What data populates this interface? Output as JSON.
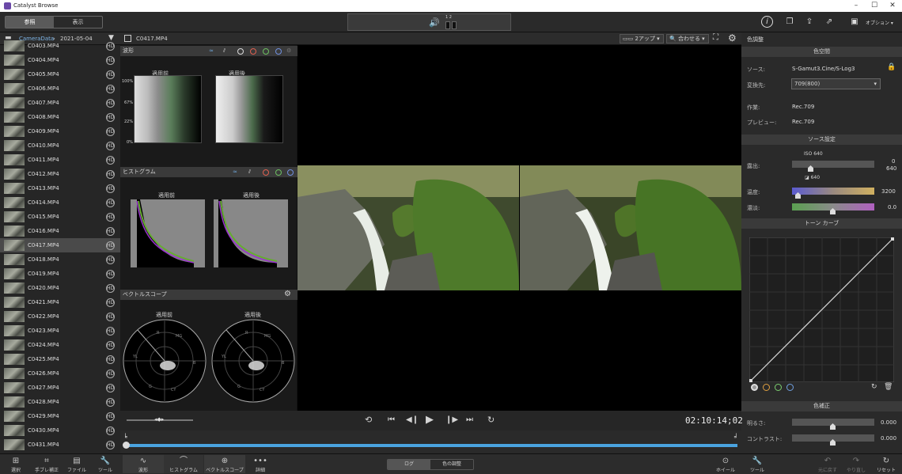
{
  "app": {
    "title": "Catalyst Browse"
  },
  "toolbar": {
    "tab_browse": "参照",
    "tab_view": "表示",
    "options": "オプション",
    "vol_top": "1 2"
  },
  "left": {
    "breadcrumb_root": "CameraData",
    "breadcrumb_date": "2021-05-04",
    "clips": [
      "C0403.MP4",
      "C0404.MP4",
      "C0405.MP4",
      "C0406.MP4",
      "C0407.MP4",
      "C0408.MP4",
      "C0409.MP4",
      "C0410.MP4",
      "C0411.MP4",
      "C0412.MP4",
      "C0413.MP4",
      "C0414.MP4",
      "C0415.MP4",
      "C0416.MP4",
      "C0417.MP4",
      "C0418.MP4",
      "C0419.MP4",
      "C0420.MP4",
      "C0421.MP4",
      "C0422.MP4",
      "C0423.MP4",
      "C0424.MP4",
      "C0425.MP4",
      "C0426.MP4",
      "C0427.MP4",
      "C0428.MP4",
      "C0429.MP4",
      "C0430.MP4",
      "C0431.MP4"
    ],
    "selected": "C0417.MP4"
  },
  "viewer": {
    "clip_name": "C0417.MP4",
    "layout": "2アップ",
    "fit": "合わせる"
  },
  "scopes": {
    "waveform": "波形",
    "histogram": "ヒストグラム",
    "vectorscope": "ベクトルスコープ",
    "before": "適用前",
    "after": "適用後",
    "wf_100": "100%",
    "wf_67": "67%",
    "wf_22": "22%",
    "wf_0": "0%",
    "vs_r": "R",
    "vs_mg": "MG",
    "vs_b": "B",
    "vs_cy": "CY",
    "vs_g": "G",
    "vs_yl": "YL"
  },
  "right": {
    "title": "色調整",
    "color_space": "色空間",
    "source_lbl": "ソース:",
    "source_val": "S-Gamut3.Cine/S-Log3",
    "convert_lbl": "変換先:",
    "convert_val": "709(800)",
    "work_lbl": "作業:",
    "work_val": "Rec.709",
    "preview_lbl": "プレビュー:",
    "preview_val": "Rec.709",
    "source_settings": "ソース設定",
    "iso": "ISO 640",
    "exposure_lbl": "露出:",
    "exposure_val": "0",
    "exposure_val2": "640",
    "exposure_sub": "640",
    "temp_lbl": "温度:",
    "temp_val": "3200",
    "tint_lbl": "濃淡:",
    "tint_val": "0.0",
    "tone_curve": "トーン カーブ",
    "color_correction": "色補正",
    "brightness_lbl": "明るさ:",
    "brightness_val": "0.000",
    "contrast_lbl": "コントラスト:",
    "contrast_val": "0.000"
  },
  "transport": {
    "timecode": "02:10:14;02"
  },
  "bottom": {
    "select": "選択",
    "stabilize": "手ブレ補正",
    "file": "ファイル",
    "tool": "ツール",
    "waveform": "波形",
    "histogram": "ヒストグラム",
    "vectorscope": "ベクトルスコープ",
    "detail": "詳細",
    "log": "ログ",
    "color_adjust": "色の調整",
    "wheel": "ホイール",
    "tool2": "ツール",
    "undo": "元に戻す",
    "redo": "やり直し",
    "reset": "リセット"
  }
}
